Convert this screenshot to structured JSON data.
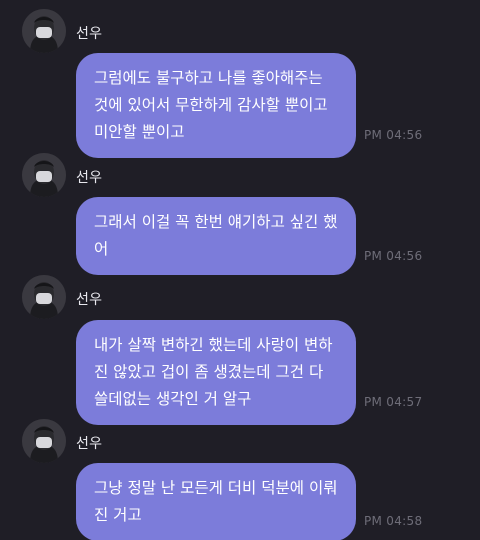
{
  "messages": [
    {
      "sender": "선우",
      "lines": [
        "그럼에도 불구하고 나를 좋아해주는",
        "것에 있어서 무한하게 감사할 뿐이고",
        "미안할 뿐이고"
      ],
      "time": "PM 04:56"
    },
    {
      "sender": "선우",
      "lines": [
        "그래서 이걸 꼭 한번 얘기하고 싶긴 했",
        "어"
      ],
      "time": "PM 04:56"
    },
    {
      "sender": "선우",
      "lines": [
        "내가 살짝 변하긴 했는데 사랑이 변하",
        "진 않았고 겁이 좀 생겼는데 그건 다",
        "쓸데없는 생각인 거 알구"
      ],
      "time": "PM 04:57"
    },
    {
      "sender": "선우",
      "lines": [
        "그냥 정말 난 모든게 더비 덕분에 이뤄",
        "진 거고"
      ],
      "time": "PM 04:58"
    }
  ],
  "colors": {
    "background": "#1f1e26",
    "bubble": "#7c7cda",
    "timestamp": "#6e6d78"
  },
  "icons": {
    "avatar": "masked-person-avatar"
  }
}
